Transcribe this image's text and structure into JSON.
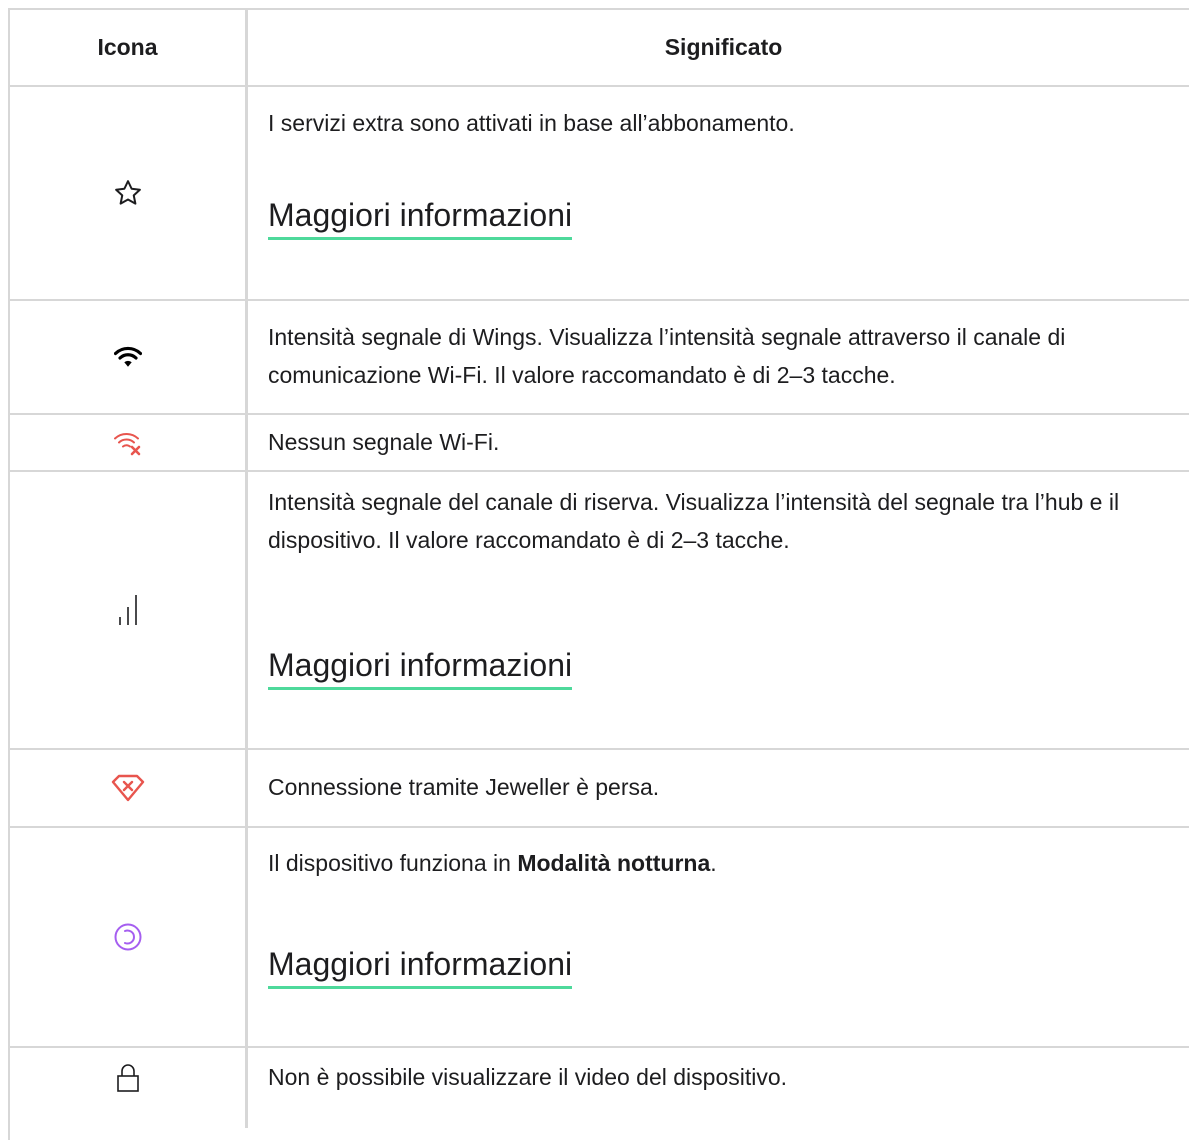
{
  "table": {
    "headers": {
      "icon": "Icona",
      "meaning": "Significato"
    },
    "rows": [
      {
        "icon": "star-icon",
        "text": "I servizi extra sono attivati in base all’abbonamento.",
        "link": "Maggiori informazioni"
      },
      {
        "icon": "wifi-icon",
        "text": "Intensità segnale di Wings. Visualizza l’intensità segnale attraverso il canale di comunicazione Wi-Fi. Il valore raccomandato è di 2–3 tacche."
      },
      {
        "icon": "wifi-off-icon",
        "text": "Nessun segnale Wi-Fi."
      },
      {
        "icon": "signal-bars-icon",
        "text": "Intensità segnale del canale di riserva. Visualizza l’intensità del segnale tra l’hub e il dispositivo. Il valore raccomandato è di 2–3 tacche.",
        "link": "Maggiori informazioni"
      },
      {
        "icon": "jeweller-lost-icon",
        "text": "Connessione tramite Jeweller è persa."
      },
      {
        "icon": "night-mode-icon",
        "text_before": "Il dispositivo funziona in ",
        "text_bold": "Modalità notturna",
        "text_after": ".",
        "link": "Maggiori informazioni"
      },
      {
        "icon": "lock-icon",
        "text": "Non è possibile visualizzare il video del dispositivo."
      }
    ]
  },
  "colors": {
    "border": "#d7d7d7",
    "link_underline": "#4ed99b",
    "error": "#e8554e",
    "night_mode": "#a55ef0"
  }
}
